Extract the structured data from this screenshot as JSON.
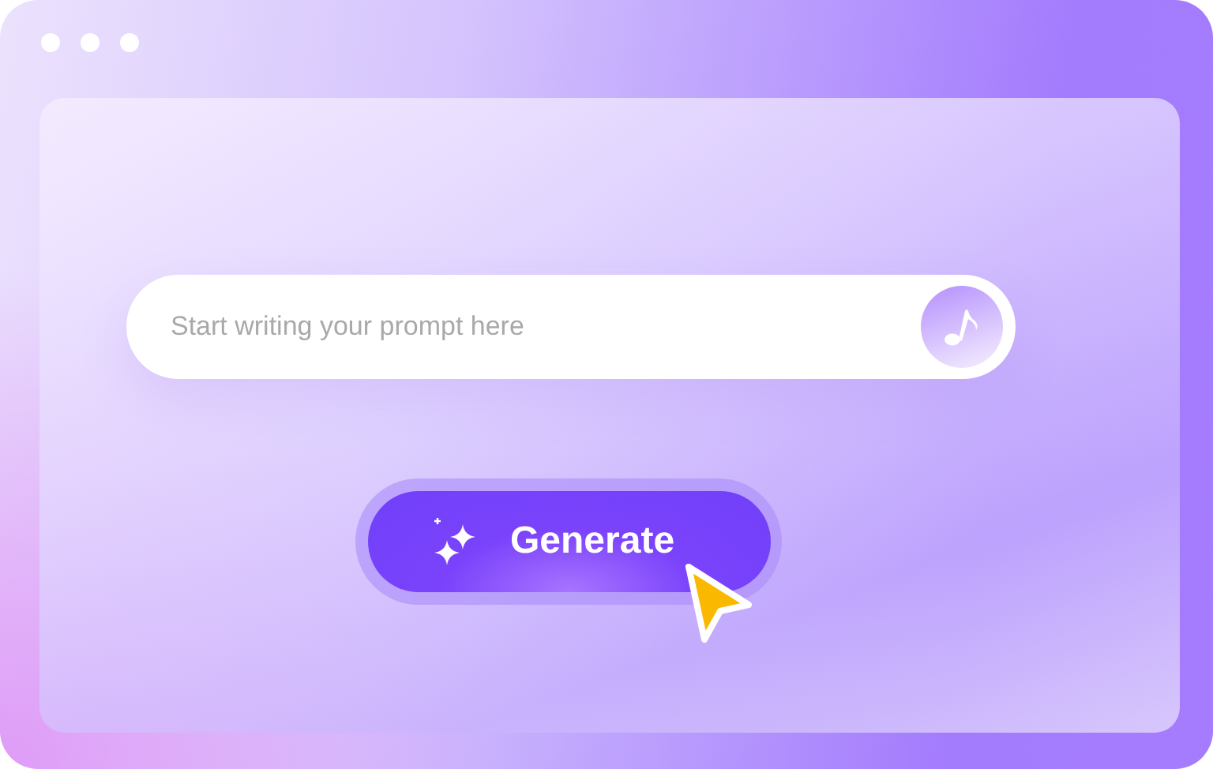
{
  "prompt": {
    "placeholder": "Start writing your prompt here"
  },
  "generate_button": {
    "label": "Generate"
  }
}
